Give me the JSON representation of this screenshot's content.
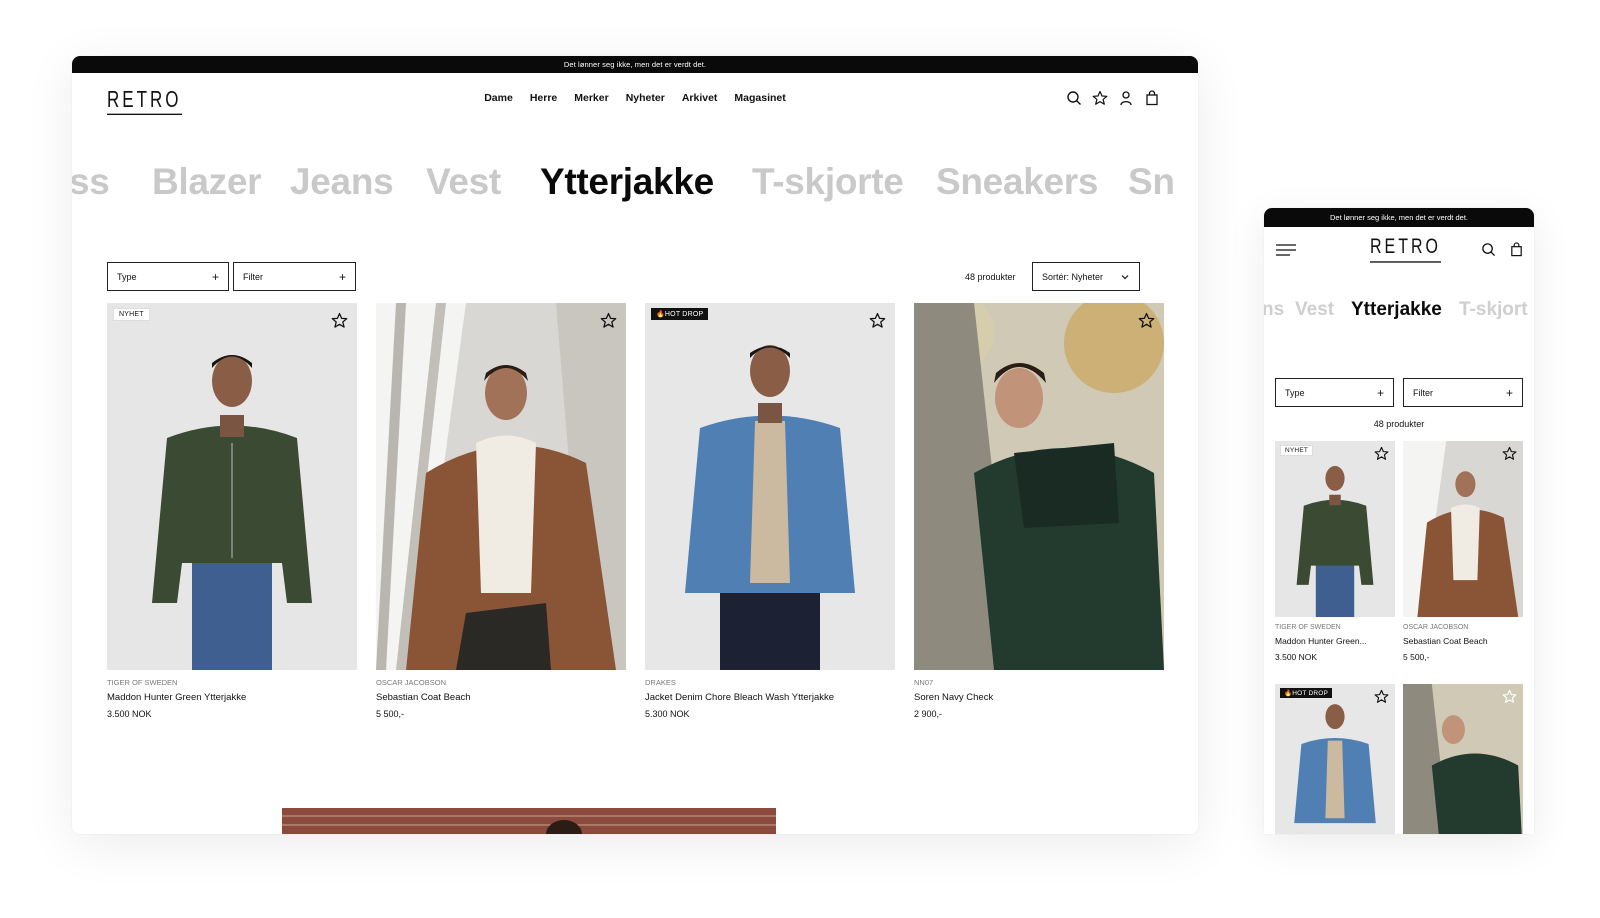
{
  "announcement": "Det lønner seg ikke, men det er verdt det.",
  "logo": "RETRO",
  "nav": [
    "Dame",
    "Herre",
    "Merker",
    "Nyheter",
    "Arkivet",
    "Magasinet"
  ],
  "icons": [
    "search-icon",
    "star-icon",
    "user-icon",
    "bag-icon",
    "menu-icon"
  ],
  "categories_desktop": [
    "ss",
    "Blazer",
    "Jeans",
    "Vest",
    "Ytterjakke",
    "T-skjorte",
    "Sneakers",
    "Sn"
  ],
  "categories_mobile": [
    "ns",
    "Vest",
    "Ytterjakke",
    "T-skjort"
  ],
  "active_category": "Ytterjakke",
  "filters": {
    "type_label": "Type",
    "filter_label": "Filter",
    "plus": "+"
  },
  "product_count": "48 produkter",
  "sort_label": "Sortér: Nyheter",
  "products": [
    {
      "badge": "NYHET",
      "brand": "TIGER OF SWEDEN",
      "name": "Maddon Hunter Green Ytterjakke",
      "short_name": "Maddon Hunter Green...",
      "price": "3.500 NOK"
    },
    {
      "badge": "",
      "brand": "OSCAR JACOBSON",
      "name": "Sebastian Coat Beach",
      "short_name": "Sebastian Coat Beach",
      "price": "5 500,-"
    },
    {
      "badge": "🔥HOT DROP",
      "brand": "DRAKES",
      "name": "Jacket Denim Chore Bleach Wash Ytterjakke",
      "short_name": "",
      "price": "5.300 NOK"
    },
    {
      "badge": "",
      "brand": "NN07",
      "name": "Soren Navy Check",
      "short_name": "",
      "price": "2 900,-"
    }
  ],
  "colors": {
    "black": "#0a0a0a",
    "inactive_word": "#c9c9c9",
    "jacket_green": "#3b4a32",
    "coat_brown": "#8a5537",
    "denim": "#4f7fb3",
    "check_green": "#233a2f"
  }
}
